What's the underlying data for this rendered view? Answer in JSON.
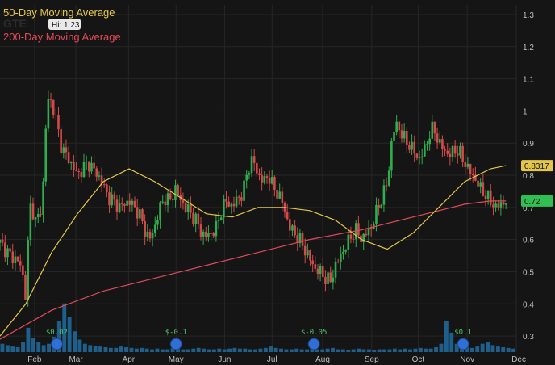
{
  "chart_data": {
    "type": "candlestick",
    "ticker_watermark": "GTE",
    "legend": [
      {
        "label": "50-Day Moving Average",
        "color": "#e4c74a"
      },
      {
        "label": "200-Day Moving Average",
        "color": "#e24a5a"
      }
    ],
    "hi_label": "Hi: 1.23",
    "y_ticks": [
      "1.3",
      "1.2",
      "1.1",
      "1",
      "0.9",
      "0.8",
      "0.7",
      "0.6",
      "0.5",
      "0.4",
      "0.3"
    ],
    "ylim": [
      0.25,
      1.33
    ],
    "x_ticks": [
      {
        "label": "Feb",
        "pos": 0.067
      },
      {
        "label": "Mar",
        "pos": 0.147
      },
      {
        "label": "Apr",
        "pos": 0.249
      },
      {
        "label": "May",
        "pos": 0.341
      },
      {
        "label": "Jun",
        "pos": 0.435
      },
      {
        "label": "Jul",
        "pos": 0.527
      },
      {
        "label": "Aug",
        "pos": 0.625
      },
      {
        "label": "Sep",
        "pos": 0.72
      },
      {
        "label": "Oct",
        "pos": 0.81
      },
      {
        "label": "Nov",
        "pos": 0.905
      },
      {
        "label": "Dec",
        "pos": 1.0
      }
    ],
    "price_badges": [
      {
        "value": "0.8317",
        "color": "#e4c74a",
        "y": 0.83
      },
      {
        "value": "0.72",
        "color": "#2fbf52",
        "y": 0.72
      }
    ],
    "events": [
      {
        "label": "$0.02",
        "x": 0.11
      },
      {
        "label": "$-0.1",
        "x": 0.341
      },
      {
        "label": "$-0.05",
        "x": 0.608
      },
      {
        "label": "$0.1",
        "x": 0.897
      }
    ],
    "close_path": [
      [
        0.0,
        0.59
      ],
      [
        0.01,
        0.57
      ],
      [
        0.02,
        0.55
      ],
      [
        0.03,
        0.54
      ],
      [
        0.04,
        0.52
      ],
      [
        0.045,
        0.48
      ],
      [
        0.05,
        0.42
      ],
      [
        0.055,
        0.62
      ],
      [
        0.06,
        0.72
      ],
      [
        0.065,
        0.68
      ],
      [
        0.07,
        0.65
      ],
      [
        0.08,
        0.7
      ],
      [
        0.085,
        0.8
      ],
      [
        0.09,
        1.0
      ],
      [
        0.095,
        1.05
      ],
      [
        0.1,
        1.02
      ],
      [
        0.105,
        1.0
      ],
      [
        0.11,
        0.96
      ],
      [
        0.115,
        0.92
      ],
      [
        0.12,
        0.88
      ],
      [
        0.13,
        0.86
      ],
      [
        0.14,
        0.83
      ],
      [
        0.15,
        0.8
      ],
      [
        0.16,
        0.82
      ],
      [
        0.17,
        0.84
      ],
      [
        0.18,
        0.82
      ],
      [
        0.19,
        0.8
      ],
      [
        0.2,
        0.77
      ],
      [
        0.21,
        0.73
      ],
      [
        0.22,
        0.72
      ],
      [
        0.23,
        0.7
      ],
      [
        0.24,
        0.71
      ],
      [
        0.25,
        0.72
      ],
      [
        0.26,
        0.7
      ],
      [
        0.27,
        0.68
      ],
      [
        0.28,
        0.63
      ],
      [
        0.29,
        0.6
      ],
      [
        0.3,
        0.64
      ],
      [
        0.31,
        0.7
      ],
      [
        0.32,
        0.73
      ],
      [
        0.33,
        0.72
      ],
      [
        0.34,
        0.76
      ],
      [
        0.35,
        0.72
      ],
      [
        0.36,
        0.7
      ],
      [
        0.37,
        0.68
      ],
      [
        0.38,
        0.66
      ],
      [
        0.39,
        0.62
      ],
      [
        0.4,
        0.61
      ],
      [
        0.41,
        0.62
      ],
      [
        0.42,
        0.64
      ],
      [
        0.43,
        0.7
      ],
      [
        0.44,
        0.72
      ],
      [
        0.45,
        0.7
      ],
      [
        0.46,
        0.73
      ],
      [
        0.47,
        0.74
      ],
      [
        0.48,
        0.82
      ],
      [
        0.49,
        0.85
      ],
      [
        0.5,
        0.8
      ],
      [
        0.51,
        0.78
      ],
      [
        0.52,
        0.8
      ],
      [
        0.53,
        0.76
      ],
      [
        0.54,
        0.74
      ],
      [
        0.55,
        0.7
      ],
      [
        0.56,
        0.64
      ],
      [
        0.57,
        0.62
      ],
      [
        0.58,
        0.6
      ],
      [
        0.59,
        0.57
      ],
      [
        0.6,
        0.54
      ],
      [
        0.61,
        0.51
      ],
      [
        0.62,
        0.5
      ],
      [
        0.63,
        0.48
      ],
      [
        0.64,
        0.47
      ],
      [
        0.65,
        0.52
      ],
      [
        0.66,
        0.55
      ],
      [
        0.67,
        0.58
      ],
      [
        0.68,
        0.61
      ],
      [
        0.69,
        0.63
      ],
      [
        0.7,
        0.6
      ],
      [
        0.71,
        0.62
      ],
      [
        0.72,
        0.64
      ],
      [
        0.73,
        0.69
      ],
      [
        0.74,
        0.73
      ],
      [
        0.75,
        0.78
      ],
      [
        0.755,
        0.84
      ],
      [
        0.76,
        0.93
      ],
      [
        0.77,
        0.96
      ],
      [
        0.78,
        0.92
      ],
      [
        0.79,
        0.9
      ],
      [
        0.8,
        0.88
      ],
      [
        0.81,
        0.85
      ],
      [
        0.82,
        0.87
      ],
      [
        0.83,
        0.92
      ],
      [
        0.84,
        0.95
      ],
      [
        0.85,
        0.9
      ],
      [
        0.86,
        0.88
      ],
      [
        0.87,
        0.86
      ],
      [
        0.88,
        0.88
      ],
      [
        0.89,
        0.87
      ],
      [
        0.9,
        0.84
      ],
      [
        0.91,
        0.81
      ],
      [
        0.92,
        0.79
      ],
      [
        0.93,
        0.76
      ],
      [
        0.94,
        0.74
      ],
      [
        0.95,
        0.72
      ],
      [
        0.96,
        0.7
      ],
      [
        0.97,
        0.71
      ],
      [
        0.98,
        0.72
      ]
    ],
    "ma50": [
      [
        0.0,
        0.3
      ],
      [
        0.05,
        0.4
      ],
      [
        0.1,
        0.56
      ],
      [
        0.15,
        0.68
      ],
      [
        0.2,
        0.78
      ],
      [
        0.25,
        0.82
      ],
      [
        0.3,
        0.78
      ],
      [
        0.35,
        0.73
      ],
      [
        0.4,
        0.68
      ],
      [
        0.45,
        0.67
      ],
      [
        0.5,
        0.7
      ],
      [
        0.55,
        0.7
      ],
      [
        0.6,
        0.69
      ],
      [
        0.65,
        0.66
      ],
      [
        0.7,
        0.6
      ],
      [
        0.75,
        0.57
      ],
      [
        0.8,
        0.62
      ],
      [
        0.85,
        0.7
      ],
      [
        0.9,
        0.78
      ],
      [
        0.95,
        0.82
      ],
      [
        0.98,
        0.83
      ]
    ],
    "ma200": [
      [
        0.0,
        0.29
      ],
      [
        0.1,
        0.38
      ],
      [
        0.2,
        0.44
      ],
      [
        0.3,
        0.48
      ],
      [
        0.4,
        0.52
      ],
      [
        0.5,
        0.56
      ],
      [
        0.55,
        0.58
      ],
      [
        0.6,
        0.6
      ],
      [
        0.7,
        0.63
      ],
      [
        0.8,
        0.67
      ],
      [
        0.9,
        0.71
      ],
      [
        0.95,
        0.72
      ],
      [
        0.98,
        0.72
      ]
    ],
    "volume": [
      0.12,
      0.1,
      0.08,
      0.07,
      0.15,
      0.35,
      0.2,
      0.14,
      0.1,
      0.12,
      0.22,
      0.45,
      0.7,
      0.5,
      0.3,
      0.18,
      0.12,
      0.1,
      0.09,
      0.08,
      0.07,
      0.06,
      0.06,
      0.08,
      0.07,
      0.06,
      0.05,
      0.06,
      0.05,
      0.04,
      0.05,
      0.04,
      0.04,
      0.06,
      0.05,
      0.04,
      0.04,
      0.05,
      0.06,
      0.05,
      0.04,
      0.04,
      0.05,
      0.04,
      0.05,
      0.06,
      0.05,
      0.05,
      0.04,
      0.04,
      0.05,
      0.06,
      0.08,
      0.06,
      0.05,
      0.04,
      0.04,
      0.05,
      0.04,
      0.04,
      0.05,
      0.04,
      0.04,
      0.05,
      0.06,
      0.04,
      0.04,
      0.03,
      0.04,
      0.05,
      0.04,
      0.04,
      0.03,
      0.04,
      0.04,
      0.04,
      0.05,
      0.04,
      0.05,
      0.04,
      0.05,
      0.06,
      0.05,
      0.05,
      0.07,
      0.12,
      0.45,
      0.28,
      0.12,
      0.08,
      0.07,
      0.06,
      0.08,
      0.12,
      0.15,
      0.1,
      0.08,
      0.07,
      0.06,
      0.05
    ]
  }
}
